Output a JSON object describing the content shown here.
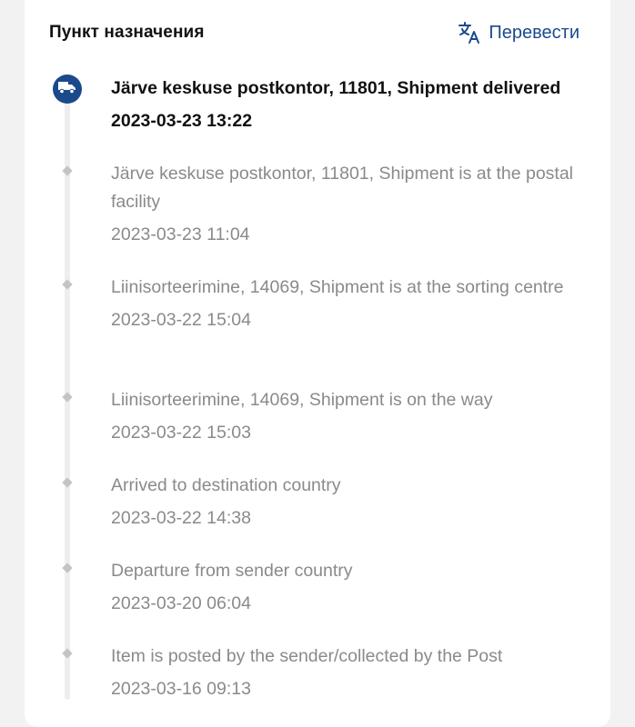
{
  "header": {
    "title": "Пункт назначения",
    "translate_label": "Перевести",
    "accent_color": "#1a4a8c"
  },
  "timeline": [
    {
      "status": "Järve keskuse postkontor, 11801, Shipment delivered",
      "time": "2023-03-23 13:22",
      "current": true,
      "icon": "truck-icon"
    },
    {
      "status": "Järve keskuse postkontor, 11801, Shipment is at the postal facility",
      "time": "2023-03-23 11:04"
    },
    {
      "status": "Liinisorteerimine, 14069, Shipment is at the sorting centre",
      "time": "2023-03-22 15:04"
    },
    {
      "status": "Liinisorteerimine, 14069, Shipment is on the way",
      "time": "2023-03-22 15:03"
    },
    {
      "status": "Arrived to destination country",
      "time": "2023-03-22 14:38"
    },
    {
      "status": "Departure from sender country",
      "time": "2023-03-20 06:04"
    },
    {
      "status": "Item is posted by the sender/collected by the Post",
      "time": "2023-03-16 09:13"
    }
  ]
}
